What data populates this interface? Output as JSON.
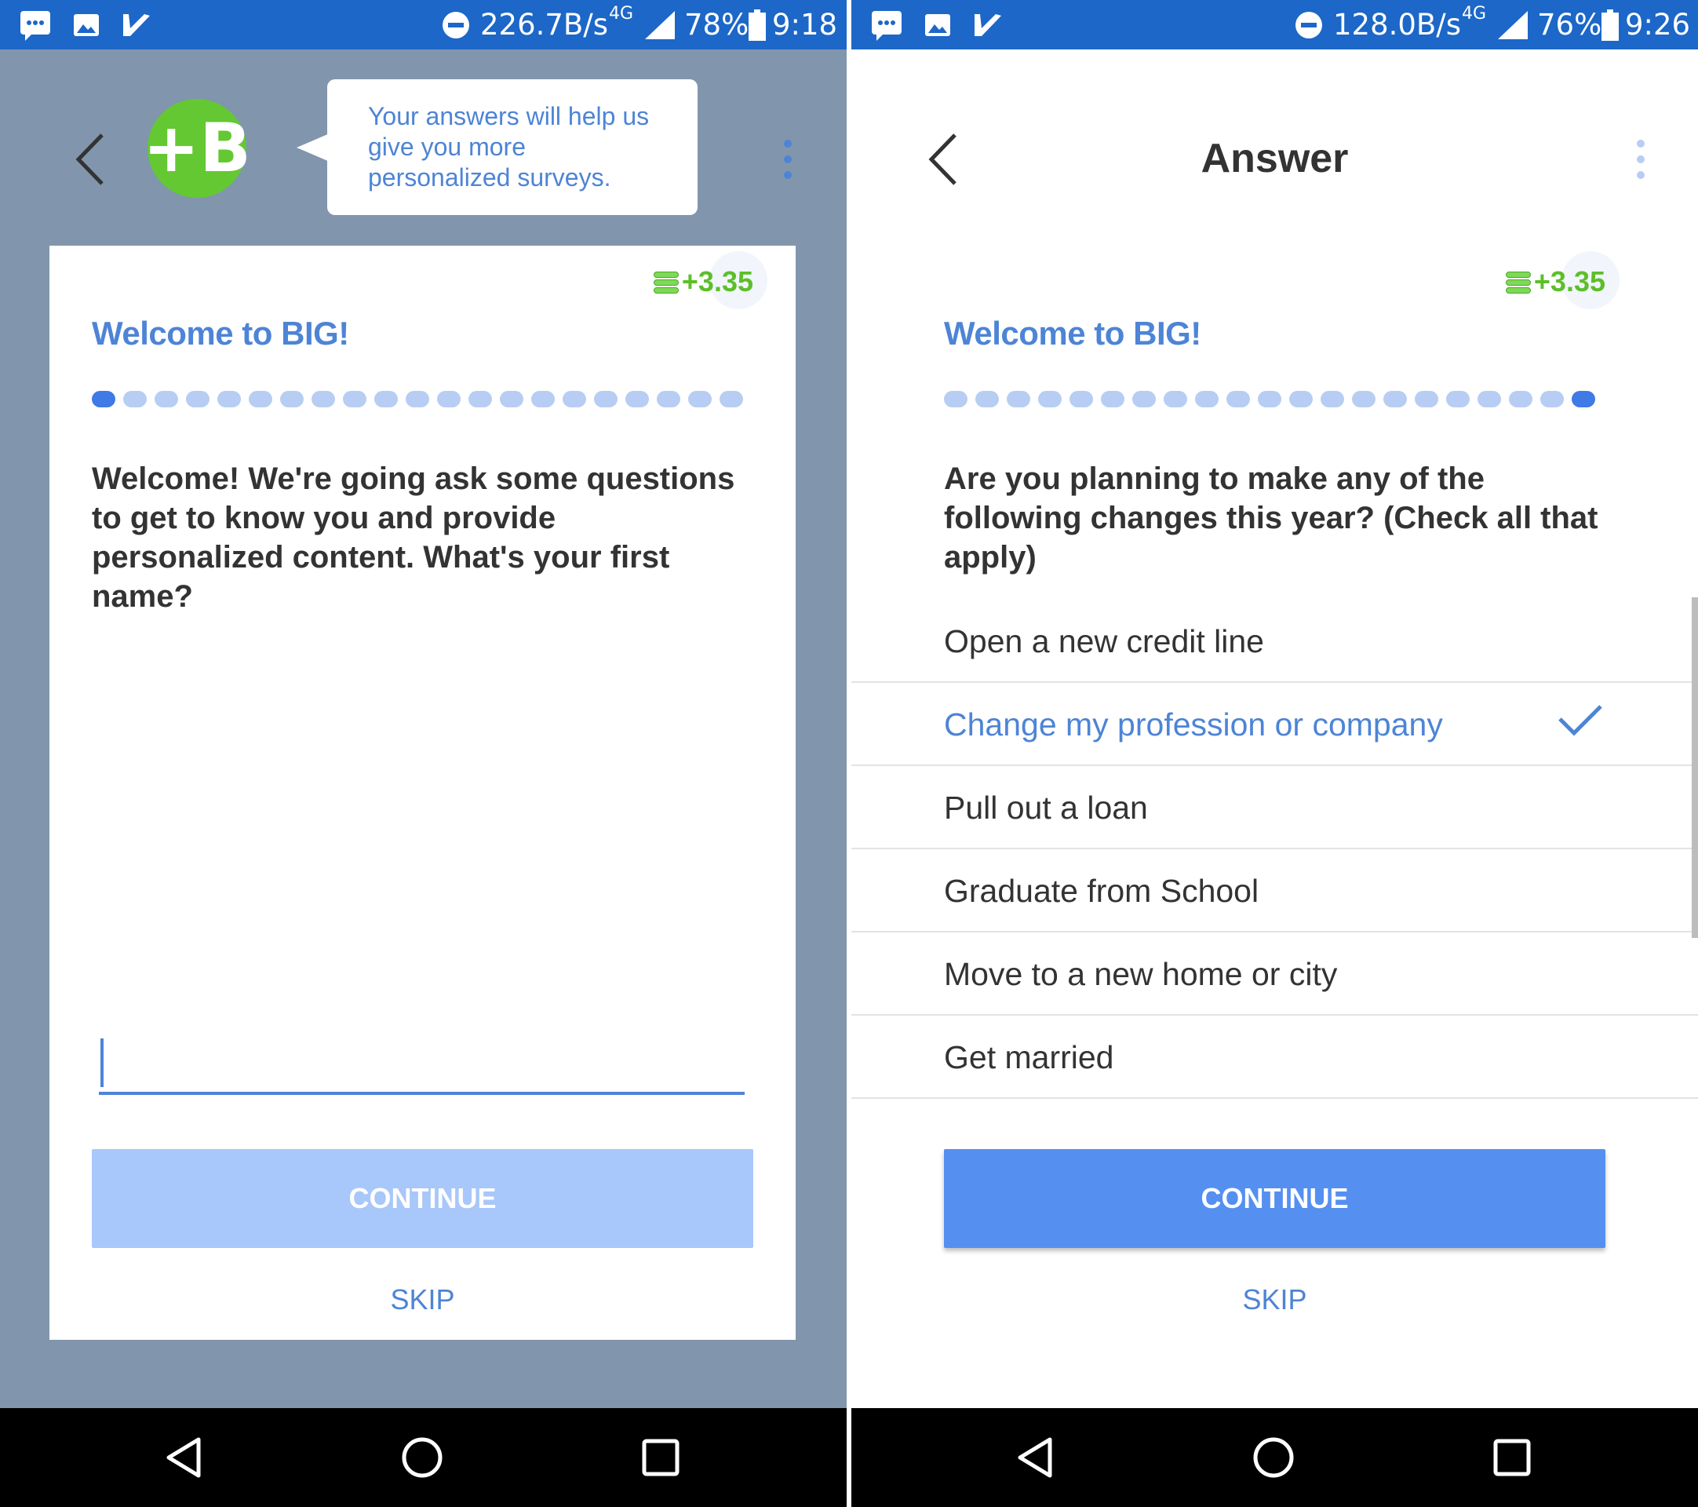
{
  "colors": {
    "status_bar": "#1c67c8",
    "accent": "#4d84d6",
    "green": "#64c833",
    "left_bg": "#8195ad",
    "button_primary": "#5590f1",
    "button_disabled": "#a8c7fa"
  },
  "left": {
    "status": {
      "speed": "226.7B/s",
      "network": "4G",
      "battery": "78%",
      "time": "9:18"
    },
    "bubble_text": "Your answers will help us give you more personalized surveys.",
    "logo_letter": "+B",
    "reward": "+3.35",
    "welcome": "Welcome to BIG!",
    "progress": {
      "total": 21,
      "current": 1
    },
    "question": "Welcome! We're going ask some questions to get to know you and provide personalized content. What's your first name?",
    "input": {
      "value": "",
      "placeholder": ""
    },
    "continue": "CONTINUE",
    "skip": "SKIP"
  },
  "right": {
    "status": {
      "speed": "128.0B/s",
      "network": "4G",
      "battery": "76%",
      "time": "9:26"
    },
    "title": "Answer",
    "reward": "+3.35",
    "welcome": "Welcome to BIG!",
    "progress": {
      "total": 21,
      "current": 21
    },
    "question": "Are you planning to make any of the following changes this year? (Check all that apply)",
    "options": [
      {
        "label": "Open a new credit line",
        "selected": false
      },
      {
        "label": "Change my profession or company",
        "selected": true
      },
      {
        "label": "Pull out a loan",
        "selected": false
      },
      {
        "label": "Graduate from School",
        "selected": false
      },
      {
        "label": "Move to a new home or city",
        "selected": false
      },
      {
        "label": "Get married",
        "selected": false
      }
    ],
    "continue": "CONTINUE",
    "skip": "SKIP"
  },
  "icons": [
    "message-icon",
    "image-icon",
    "checkmark-app-icon",
    "dnd-icon",
    "signal-icon",
    "battery-icon",
    "back-icon",
    "more-icon",
    "coin-stack-icon",
    "check-icon",
    "nav-back-icon",
    "nav-home-icon",
    "nav-recents-icon"
  ]
}
